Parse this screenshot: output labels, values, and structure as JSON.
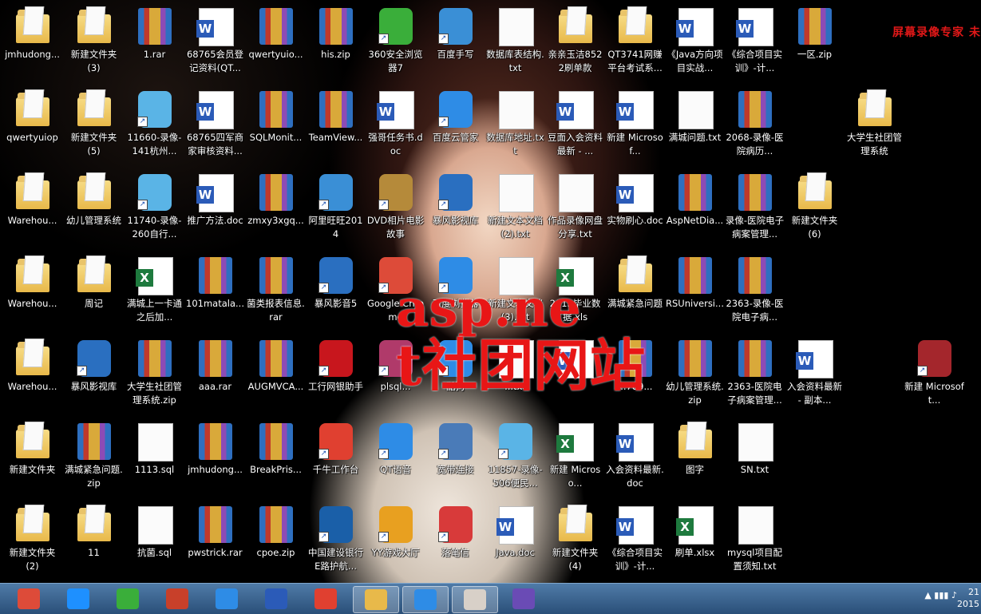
{
  "watermark": {
    "top_right": "屏幕录像专家 未",
    "line1": "asp.ne",
    "line2": "t社团网站"
  },
  "icons": [
    {
      "label": "jmhudong...",
      "type": "folder",
      "color": "#e8b94a"
    },
    {
      "label": "新建文件夹 (3)",
      "type": "folder",
      "color": "#e8b94a"
    },
    {
      "label": "1.rar",
      "type": "rar",
      "color": "#2e6fc0"
    },
    {
      "label": "68765会员登记资料(QT...",
      "type": "doc",
      "color": "#2b5bb8"
    },
    {
      "label": "qwertyuio...",
      "type": "rar",
      "color": "#2e6fc0"
    },
    {
      "label": "his.zip",
      "type": "rar",
      "color": "#2e6fc0"
    },
    {
      "label": "360安全浏览器7",
      "type": "app",
      "color": "#3aae3a"
    },
    {
      "label": "百度手写",
      "type": "app",
      "color": "#3a8fd6"
    },
    {
      "label": "数据库表结构.txt",
      "type": "txt",
      "color": "#ffffff"
    },
    {
      "label": "亲亲玉洁8522刷单款",
      "type": "folder",
      "color": "#e8b94a"
    },
    {
      "label": "QT3741网赚平台考试系...",
      "type": "folder",
      "color": "#e8b94a"
    },
    {
      "label": "《Java方向项目实战...",
      "type": "doc",
      "color": "#2b5bb8"
    },
    {
      "label": "《综合项目实训》-计...",
      "type": "doc",
      "color": "#2b5bb8"
    },
    {
      "label": "一区.zip",
      "type": "rar",
      "color": "#2e6fc0"
    },
    {
      "label": "qwertyuiop",
      "type": "folder",
      "color": "#e8b94a"
    },
    {
      "label": "新建文件夹 (5)",
      "type": "folder",
      "color": "#e8b94a"
    },
    {
      "label": "11660-录像-141杭州...",
      "type": "app",
      "color": "#5ab4e6"
    },
    {
      "label": "68765四军商家审核资料...",
      "type": "doc",
      "color": "#2b5bb8"
    },
    {
      "label": "SQLMonit...",
      "type": "rar",
      "color": "#2e6fc0"
    },
    {
      "label": "TeamView...",
      "type": "rar",
      "color": "#2e6fc0"
    },
    {
      "label": "强哥任务书.doc",
      "type": "doc",
      "color": "#2b5bb8"
    },
    {
      "label": "百度云管家",
      "type": "app",
      "color": "#2e8ce6"
    },
    {
      "label": "数据库地址.txt",
      "type": "txt",
      "color": "#ffffff"
    },
    {
      "label": "豆面入会资料最新 - ...",
      "type": "doc",
      "color": "#2b5bb8"
    },
    {
      "label": "新建 Microsof...",
      "type": "doc",
      "color": "#2b5bb8"
    },
    {
      "label": "满城问题.txt",
      "type": "txt",
      "color": "#ffffff"
    },
    {
      "label": "2068-录像-医院病历...",
      "type": "rar",
      "color": "#2e6fc0"
    },
    {
      "label": "大学生社团管理系统",
      "type": "folder",
      "color": "#e8b94a"
    },
    {
      "label": "Warehou...",
      "type": "folder",
      "color": "#e8b94a"
    },
    {
      "label": "幼儿管理系统",
      "type": "folder",
      "color": "#e8b94a"
    },
    {
      "label": "11740-录像-260自行...",
      "type": "app",
      "color": "#5ab4e6"
    },
    {
      "label": "推广方法.doc",
      "type": "doc",
      "color": "#2b5bb8"
    },
    {
      "label": "zmxy3xgq...",
      "type": "rar",
      "color": "#2e6fc0"
    },
    {
      "label": "阿里旺旺2014",
      "type": "app",
      "color": "#3a8fd6"
    },
    {
      "label": "DVD相片电影故事",
      "type": "app",
      "color": "#b58a3a"
    },
    {
      "label": "暴风影视库",
      "type": "app",
      "color": "#2a6fc0"
    },
    {
      "label": "新建文本文档 (2).txt",
      "type": "txt",
      "color": "#ffffff"
    },
    {
      "label": "作品录像网盘分享.txt",
      "type": "txt",
      "color": "#ffffff"
    },
    {
      "label": "实物刷心.doc",
      "type": "doc",
      "color": "#2b5bb8"
    },
    {
      "label": "AspNetDia...",
      "type": "rar",
      "color": "#2e6fc0"
    },
    {
      "label": "录像-医院电子病案管理...",
      "type": "rar",
      "color": "#2e6fc0"
    },
    {
      "label": "新建文件夹 (6)",
      "type": "folder",
      "color": "#e8b94a"
    },
    {
      "label": "Warehou...",
      "type": "folder",
      "color": "#e8b94a"
    },
    {
      "label": "周记",
      "type": "folder",
      "color": "#e8b94a"
    },
    {
      "label": "满城上一卡通之后加...",
      "type": "xls",
      "color": "#1e7a3e"
    },
    {
      "label": "101matala...",
      "type": "rar",
      "color": "#2e6fc0"
    },
    {
      "label": "菌类报表信息.rar",
      "type": "rar",
      "color": "#2e6fc0"
    },
    {
      "label": "暴风影音5",
      "type": "app",
      "color": "#2a6fc0"
    },
    {
      "label": "Google Chrome",
      "type": "app",
      "color": "#dd4b39"
    },
    {
      "label": "百度浏览器",
      "type": "app",
      "color": "#2e8ce6"
    },
    {
      "label": "新建文本文档 (3).txt",
      "type": "txt",
      "color": "#ffffff"
    },
    {
      "label": "2013毕业数据.xls",
      "type": "xls",
      "color": "#1e7a3e"
    },
    {
      "label": "满城紧急问题",
      "type": "folder",
      "color": "#e8b94a"
    },
    {
      "label": "RSUniversi...",
      "type": "rar",
      "color": "#2e6fc0"
    },
    {
      "label": "2363-录像-医院电子病...",
      "type": "rar",
      "color": "#2e6fc0"
    },
    {
      "label": "Warehou...",
      "type": "folder",
      "color": "#e8b94a"
    },
    {
      "label": "暴风影视库",
      "type": "app",
      "color": "#2a6fc0"
    },
    {
      "label": "大学生社团管理系统.zip",
      "type": "rar",
      "color": "#2e6fc0"
    },
    {
      "label": "aaa.rar",
      "type": "rar",
      "color": "#2e6fc0"
    },
    {
      "label": "AUGMVCA...",
      "type": "rar",
      "color": "#2e6fc0"
    },
    {
      "label": "工行网银助手",
      "type": "app",
      "color": "#c8161d"
    },
    {
      "label": "plsql...",
      "type": "app",
      "color": "#b03a6a"
    },
    {
      "label": "酷狗",
      "type": "app",
      "color": "#2e8ce6"
    },
    {
      "label": "...txt",
      "type": "txt",
      "color": "#ffffff"
    },
    {
      "label": "...",
      "type": "doc",
      "color": "#2b5bb8"
    },
    {
      "label": "...789...",
      "type": "rar",
      "color": "#2e6fc0"
    },
    {
      "label": "幼儿管理系统.zip",
      "type": "rar",
      "color": "#2e6fc0"
    },
    {
      "label": "2363-医院电子病案管理...",
      "type": "rar",
      "color": "#2e6fc0"
    },
    {
      "label": "入会资料最新 - 副本...",
      "type": "doc",
      "color": "#2b5bb8"
    },
    {
      "label": "新建 Microsoft...",
      "type": "app",
      "color": "#a4262c"
    },
    {
      "label": "新建文件夹",
      "type": "folder",
      "color": "#e8b94a"
    },
    {
      "label": "满城紧急问题.zip",
      "type": "rar",
      "color": "#2e6fc0"
    },
    {
      "label": "1113.sql",
      "type": "txt",
      "color": "#ffffff"
    },
    {
      "label": "jmhudong...",
      "type": "rar",
      "color": "#2e6fc0"
    },
    {
      "label": "BreakPris...",
      "type": "rar",
      "color": "#2e6fc0"
    },
    {
      "label": "千牛工作台",
      "type": "app",
      "color": "#e04030"
    },
    {
      "label": "QT语音",
      "type": "app",
      "color": "#2e8ce6"
    },
    {
      "label": "宽带连接",
      "type": "app",
      "color": "#4a7bb8"
    },
    {
      "label": "11857-录像-506便民...",
      "type": "app",
      "color": "#5ab4e6"
    },
    {
      "label": "新建 Microso...",
      "type": "xls",
      "color": "#1e7a3e"
    },
    {
      "label": "入会资料最新.doc",
      "type": "doc",
      "color": "#2b5bb8"
    },
    {
      "label": "图字",
      "type": "folder",
      "color": "#e8b94a"
    },
    {
      "label": "SN.txt",
      "type": "txt",
      "color": "#ffffff"
    },
    {
      "label": "新建文件夹 (2)",
      "type": "folder",
      "color": "#e8b94a"
    },
    {
      "label": "11",
      "type": "folder",
      "color": "#e8b94a"
    },
    {
      "label": "抗菌.sql",
      "type": "txt",
      "color": "#ffffff"
    },
    {
      "label": "pwstrick.rar",
      "type": "rar",
      "color": "#2e6fc0"
    },
    {
      "label": "cpoe.zip",
      "type": "rar",
      "color": "#2e6fc0"
    },
    {
      "label": "中国建设银行E路护航...",
      "type": "app",
      "color": "#1a5fa8"
    },
    {
      "label": "YY游戏大厅",
      "type": "app",
      "color": "#e8a020"
    },
    {
      "label": "落笔信",
      "type": "app",
      "color": "#d83a3a"
    },
    {
      "label": "Java.doc",
      "type": "doc",
      "color": "#2b5bb8"
    },
    {
      "label": "新建文件夹 (4)",
      "type": "folder",
      "color": "#e8b94a"
    },
    {
      "label": "《综合项目实训》-计...",
      "type": "doc",
      "color": "#2b5bb8"
    },
    {
      "label": "刷单.xlsx",
      "type": "xls",
      "color": "#1e7a3e"
    },
    {
      "label": "mysql项目配置须知.txt",
      "type": "txt",
      "color": "#ffffff"
    }
  ],
  "taskbar": {
    "apps": [
      {
        "name": "chrome-taskbar-icon",
        "color": "#dd4b39"
      },
      {
        "name": "ie-taskbar-icon",
        "color": "#1e90ff"
      },
      {
        "name": "360-browser-taskbar-icon",
        "color": "#3aae3a"
      },
      {
        "name": "ccleaner-taskbar-icon",
        "color": "#c8402a"
      },
      {
        "name": "baidu-cloud-taskbar-icon",
        "color": "#2e8ce6"
      },
      {
        "name": "word-taskbar-icon",
        "color": "#2b5bb8"
      },
      {
        "name": "qianniu-taskbar-icon",
        "color": "#e04030"
      },
      {
        "name": "explorer-taskbar-icon",
        "color": "#e8b94a"
      },
      {
        "name": "qt-taskbar-icon",
        "color": "#2e8ce6"
      },
      {
        "name": "recorder-taskbar-icon",
        "color": "#d8d0c8"
      },
      {
        "name": "vs-taskbar-icon",
        "color": "#6a4bb5"
      }
    ],
    "clock_time": "21",
    "clock_date": "2015"
  }
}
